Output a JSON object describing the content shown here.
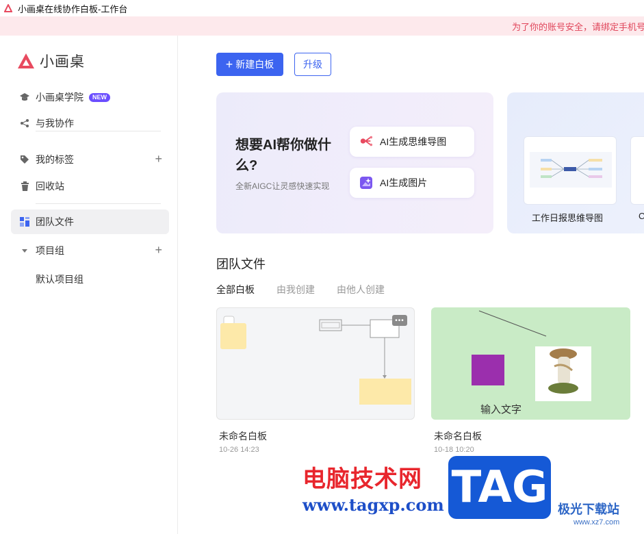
{
  "window": {
    "title": "小画桌在线协作白板-工作台"
  },
  "notice": {
    "text": "为了你的账号安全，请绑定手机号"
  },
  "brand": {
    "name": "小画桌",
    "color": "#e84a5f"
  },
  "sidebar": {
    "academy": {
      "label": "小画桌学院",
      "badge": "NEW"
    },
    "collab": {
      "label": "与我协作"
    },
    "tags": {
      "label": "我的标签"
    },
    "trash": {
      "label": "回收站"
    },
    "team_files": {
      "label": "团队文件"
    },
    "project_group": {
      "label": "项目组"
    },
    "default_group": {
      "label": "默认项目组"
    }
  },
  "toolbar": {
    "new_board": "新建白板",
    "upgrade": "升级",
    "accent": "#3c64f0"
  },
  "ai_card": {
    "title": "想要AI帮你做什么?",
    "subtitle": "全新AIGC让灵感快速实现",
    "mindmap": "AI生成思维导图",
    "image": "AI生成图片"
  },
  "templates": {
    "items": [
      {
        "label": "工作日报思维导图"
      },
      {
        "label": "C"
      }
    ]
  },
  "files": {
    "section_title": "团队文件",
    "tabs": [
      "全部白板",
      "由我创建",
      "由他人创建"
    ],
    "cards": [
      {
        "name": "未命名白板",
        "date": "10-26 14:23"
      },
      {
        "name": "未命名白板",
        "date": "10-18 10:20",
        "canvas_text": "输入文字"
      }
    ]
  },
  "watermark": {
    "cn": "电脑技术网",
    "url": "www.tagxp.com",
    "tag": "TAG",
    "site": "极光下载站",
    "site_url": "www.xz7.com"
  }
}
